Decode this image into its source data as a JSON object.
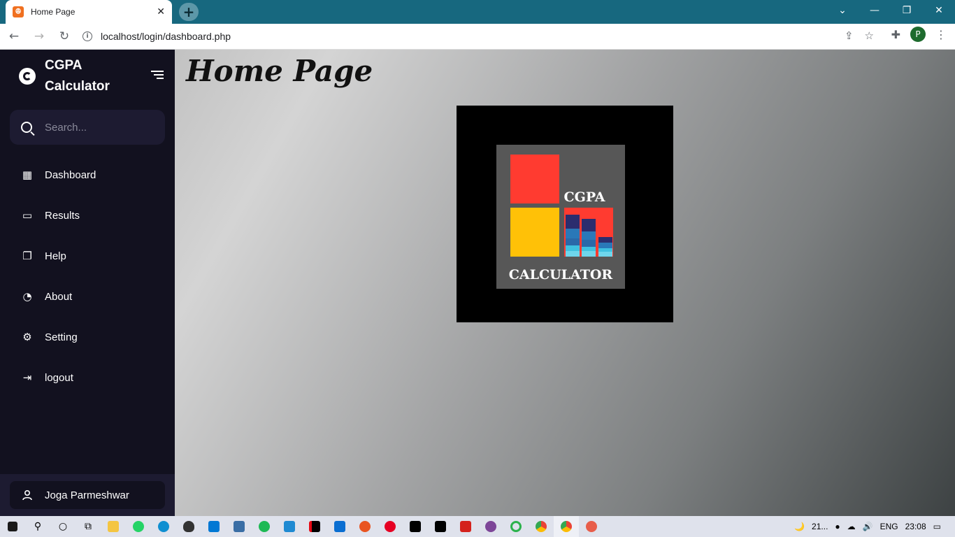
{
  "browser": {
    "tab_title": "Home Page",
    "tab_close": "✕",
    "new_tab": "+",
    "url": "localhost/login/dashboard.php",
    "profile_initial": "P",
    "window_controls": [
      "⌄",
      "—",
      "❐",
      "✕"
    ]
  },
  "sidebar": {
    "brand": "CGPA Calculator",
    "search_placeholder": "Search...",
    "items": [
      {
        "label": "Dashboard",
        "icon": "▦"
      },
      {
        "label": "Results",
        "icon": "▭"
      },
      {
        "label": "Help",
        "icon": "❐"
      },
      {
        "label": "About",
        "icon": "◔"
      },
      {
        "label": "Setting",
        "icon": "⚙"
      },
      {
        "label": "logout",
        "icon": "⇥"
      }
    ],
    "user_name": "Joga Parmeshwar"
  },
  "main": {
    "title": "Home Page",
    "logo": {
      "line1": "CGPA",
      "line2": "CALCULATOR",
      "colors": {
        "red": "#ff3b30",
        "yellow": "#ffc107",
        "navy": "#2b2d6e",
        "blue": "#2a78b8",
        "cyan": "#3fc1e0"
      }
    }
  },
  "taskbar": {
    "weather": "21...",
    "language": "ENG",
    "time": "23:08"
  }
}
